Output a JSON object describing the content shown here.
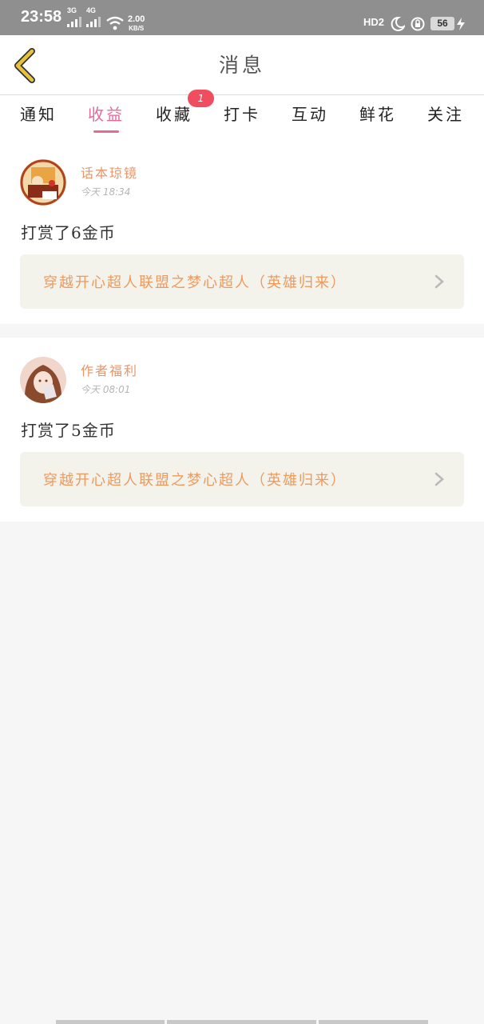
{
  "status_bar": {
    "time": "23:58",
    "net1": "3G",
    "net2": "4G",
    "speed_value": "2.00",
    "speed_unit": "KB/S",
    "hd": "HD2",
    "battery": "56"
  },
  "header": {
    "title": "消息",
    "back_icon": "chevron-left-icon"
  },
  "tabs": [
    {
      "label": "通知"
    },
    {
      "label": "收益",
      "active": true
    },
    {
      "label": "收藏",
      "badge": "1"
    },
    {
      "label": "打卡"
    },
    {
      "label": "互动"
    },
    {
      "label": "鲜花"
    },
    {
      "label": "关注"
    }
  ],
  "messages": [
    {
      "username": "话本琼镜",
      "time": "今天 18:34",
      "text": "打赏了6金币",
      "book": "穿越开心超人联盟之梦心超人（英雄归来）"
    },
    {
      "username": "作者福利",
      "time": "今天 08:01",
      "text": "打赏了5金币",
      "book": "穿越开心超人联盟之梦心超人（英雄归来）"
    }
  ],
  "colors": {
    "accent": "#e36a9a",
    "username": "#e6966a",
    "book_link": "#ee9a5e",
    "badge": "#f04d5e",
    "back_icon": "#e8c23c"
  }
}
